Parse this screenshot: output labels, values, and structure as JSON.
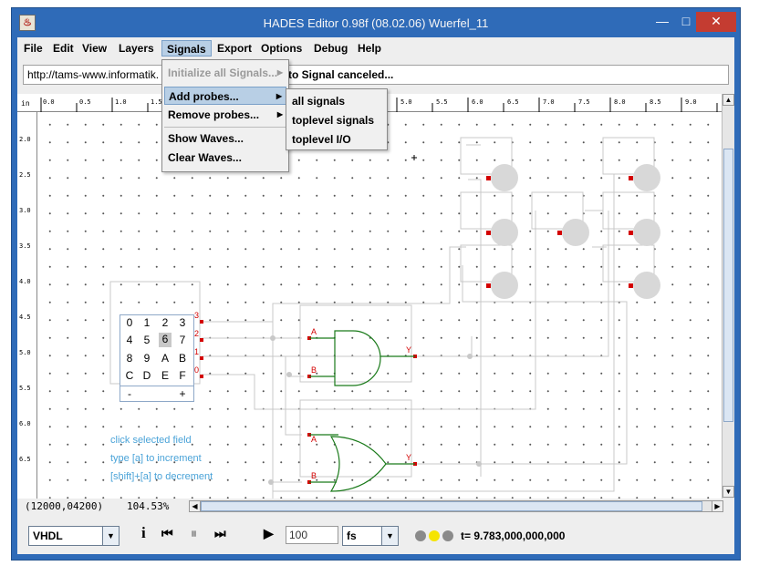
{
  "window": {
    "title": "HADES Editor 0.98f (08.02.06)   Wuerfel_11",
    "app_icon": "java-cup-icon",
    "controls": {
      "minimize": "—",
      "maximize": "□",
      "close": "✕"
    }
  },
  "menubar": {
    "items": [
      {
        "label": "File"
      },
      {
        "label": "Edit"
      },
      {
        "label": "View"
      },
      {
        "label": "Layers"
      },
      {
        "label": "Signals"
      },
      {
        "label": "Export"
      },
      {
        "label": "Options"
      },
      {
        "label": "Debug"
      },
      {
        "label": "Help"
      }
    ]
  },
  "status": {
    "url": "http://tams-www.informatik.",
    "message": "e to Signal canceled..."
  },
  "signals_menu": {
    "items": [
      {
        "label": "Initialize all Signals..."
      },
      {
        "label": "Add probes..."
      },
      {
        "label": "Remove probes..."
      },
      {
        "label": "Show Waves..."
      },
      {
        "label": "Clear Waves..."
      }
    ]
  },
  "probes_submenu": {
    "items": [
      {
        "label": "all signals"
      },
      {
        "label": "toplevel signals"
      },
      {
        "label": "toplevel I/O"
      }
    ]
  },
  "ruler": {
    "unit": "in",
    "top_labels": [
      "0.0",
      "0.5",
      "1.0",
      "1.5",
      "5.0",
      "5.5",
      "6.0",
      "6.5",
      "7.0",
      "7.5",
      "8.0",
      "8.5",
      "9.0"
    ],
    "left_labels": [
      "2.0",
      "2.5",
      "3.0",
      "3.5",
      "4.0",
      "4.5",
      "5.0",
      "5.5",
      "6.0",
      "6.5"
    ]
  },
  "circuit": {
    "hex_keypad": {
      "keys": [
        "0",
        "1",
        "2",
        "3",
        "4",
        "5",
        "6",
        "7",
        "8",
        "9",
        "A",
        "B",
        "C",
        "D",
        "E",
        "F"
      ],
      "selected_key": "6",
      "minus": "-",
      "plus": "+"
    },
    "keypad_outputs": [
      "3",
      "2",
      "1",
      "0"
    ],
    "gate_pins": {
      "and_a": "A",
      "and_b": "B",
      "and_y": "Y",
      "or_a": "A",
      "or_b": "B",
      "or_y": "Y"
    },
    "hints": [
      "click selected field",
      "type [a] to increment",
      "[shift]+[a] to decrement"
    ]
  },
  "info": {
    "coords": "(12000,04200)",
    "zoom": "104.53%"
  },
  "toolbar": {
    "language": "VHDL",
    "sim_time_value": "100",
    "time_unit": "fs",
    "time_readout": "t= 9.783,000,000,000",
    "icons": [
      "info-icon",
      "rewind-icon",
      "pause-icon",
      "fast-forward-icon",
      "play-icon"
    ]
  },
  "colors": {
    "title_bar": "#2f6bb8",
    "menu_highlight": "#b8cfe5",
    "wire": "#c8c8c8",
    "gate": "#1a7a1a",
    "pin": "#d40000",
    "hint_text": "#4aa3d8",
    "led_off": "#c8c8c8"
  }
}
